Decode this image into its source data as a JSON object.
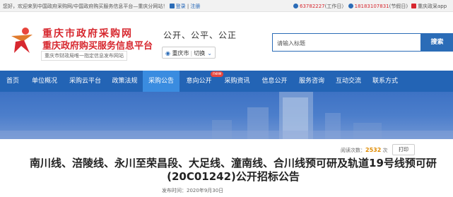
{
  "topbar": {
    "welcome": "您好，欢迎来到中国政府采购网/中国政府购买服务信息平台—重庆分网站！",
    "login": "登录",
    "register": "注册",
    "phone1": "63782227",
    "phone1_note": "(工作日）",
    "phone2": "18183107831",
    "phone2_note": "(节假日)",
    "app_label": "重庆政采app"
  },
  "header": {
    "brand_line1": "重庆市政府采购网",
    "brand_line2": "重庆政府购买服务信息平台",
    "brand_note": "重庆市财政局唯一指定信息发布网站",
    "slogan": "公开、公平、公正",
    "region": "重庆市",
    "region_switch": "切换",
    "search_placeholder": "请输入标题",
    "search_button": "搜索"
  },
  "nav": {
    "items": [
      "首页",
      "单位概况",
      "采购云平台",
      "政策法规",
      "采购公告",
      "意向公开",
      "采购资讯",
      "信息公开",
      "服务咨询",
      "互动交流",
      "联系方式"
    ],
    "active": "采购公告",
    "new_badge": "new"
  },
  "article": {
    "read_label": "阅读次数：",
    "read_count": "2532",
    "read_unit": "次",
    "print_button": "打印",
    "title": "南川线、涪陵线、永川至荣昌段、大足线、潼南线、合川线预可研及轨道19号线预可研(20C01242)公开招标公告",
    "date_label": "发布时间：",
    "date": "2020年9月30日"
  },
  "colors": {
    "brand_red": "#d7282f",
    "nav_blue": "#2364b5",
    "nav_active": "#3a8ce0",
    "read_count": "#e08b00"
  }
}
